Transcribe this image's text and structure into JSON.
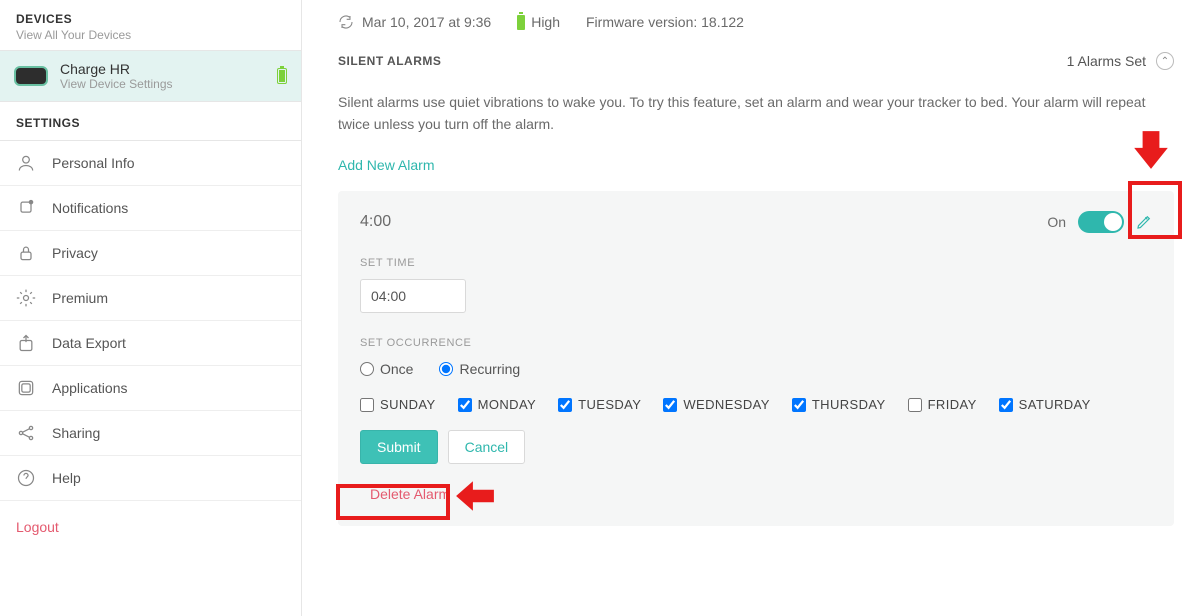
{
  "sidebar": {
    "devices_title": "DEVICES",
    "devices_sub": "View All Your Devices",
    "device": {
      "name": "Charge HR",
      "sub": "View Device Settings"
    },
    "settings_title": "SETTINGS",
    "items": [
      {
        "label": "Personal Info",
        "icon": "user-icon"
      },
      {
        "label": "Notifications",
        "icon": "bell-icon"
      },
      {
        "label": "Privacy",
        "icon": "lock-icon"
      },
      {
        "label": "Premium",
        "icon": "gear-icon"
      },
      {
        "label": "Data Export",
        "icon": "upload-icon"
      },
      {
        "label": "Applications",
        "icon": "grid-icon"
      },
      {
        "label": "Sharing",
        "icon": "share-icon"
      },
      {
        "label": "Help",
        "icon": "help-icon"
      }
    ],
    "logout_label": "Logout"
  },
  "status": {
    "sync": "Mar 10, 2017 at 9:36",
    "battery": "High",
    "firmware_label": "Firmware version:",
    "firmware_value": "18.122"
  },
  "section": {
    "title": "SILENT ALARMS",
    "count_label": "1 Alarms Set",
    "desc": "Silent alarms use quiet vibrations to wake you. To try this feature, set an alarm and wear your tracker to bed. Your alarm will repeat twice unless you turn off the alarm.",
    "add_link": "Add New Alarm"
  },
  "alarm": {
    "display_time": "4:00",
    "toggle_label": "On",
    "set_time_label": "SET TIME",
    "time_value": "04:00",
    "occ_label": "SET OCCURRENCE",
    "once_label": "Once",
    "recurring_label": "Recurring",
    "occurrence": "recurring",
    "days": [
      {
        "label": "SUNDAY",
        "checked": false
      },
      {
        "label": "MONDAY",
        "checked": true
      },
      {
        "label": "TUESDAY",
        "checked": true
      },
      {
        "label": "WEDNESDAY",
        "checked": true
      },
      {
        "label": "THURSDAY",
        "checked": true
      },
      {
        "label": "FRIDAY",
        "checked": false
      },
      {
        "label": "SATURDAY",
        "checked": true
      }
    ],
    "submit_label": "Submit",
    "cancel_label": "Cancel",
    "delete_label": "Delete Alarm"
  }
}
